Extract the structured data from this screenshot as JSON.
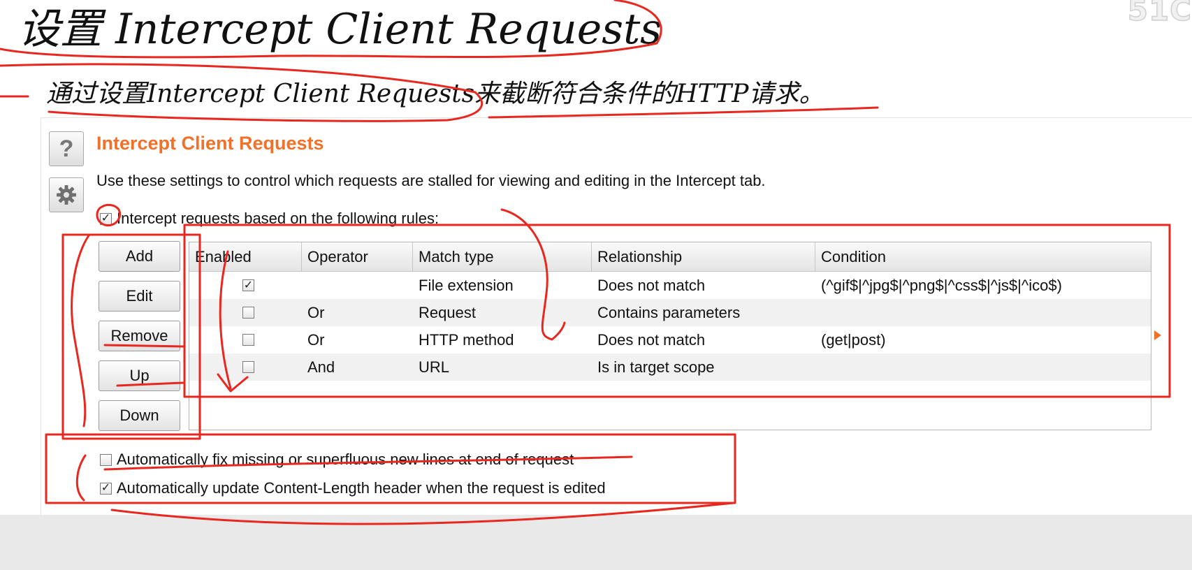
{
  "slide": {
    "title": "设置 Intercept Client Requests",
    "subtitle": "通过设置Intercept Client Requests来截断符合条件的HTTP请求。"
  },
  "panel": {
    "help_glyph": "?",
    "title": "Intercept Client Requests",
    "description": "Use these settings to control which requests are stalled for viewing and editing in the Intercept tab.",
    "intercept_rules": {
      "label": "Intercept requests based on the following rules:",
      "checked": true
    },
    "buttons": {
      "add": "Add",
      "edit": "Edit",
      "remove": "Remove",
      "up": "Up",
      "down": "Down"
    },
    "table": {
      "columns": [
        "Enabled",
        "Operator",
        "Match type",
        "Relationship",
        "Condition"
      ],
      "rows": [
        {
          "enabled": true,
          "operator": "",
          "match_type": "File extension",
          "relationship": "Does not match",
          "condition": "(^gif$|^jpg$|^png$|^css$|^js$|^ico$)"
        },
        {
          "enabled": false,
          "operator": "Or",
          "match_type": "Request",
          "relationship": "Contains parameters",
          "condition": ""
        },
        {
          "enabled": false,
          "operator": "Or",
          "match_type": "HTTP method",
          "relationship": "Does not match",
          "condition": "(get|post)"
        },
        {
          "enabled": false,
          "operator": "And",
          "match_type": "URL",
          "relationship": "Is in target scope",
          "condition": ""
        }
      ]
    },
    "options": [
      {
        "label": "Automatically fix missing or superfluous new lines at end of request",
        "checked": false
      },
      {
        "label": "Automatically update Content-Length header when the request is edited",
        "checked": true
      }
    ]
  },
  "colors": {
    "accent": "#f0712a",
    "annotation": "#e8281e",
    "row_alt": "#f1f1f1"
  },
  "icons": [
    "help-icon",
    "gear-icon",
    "checkbox-checked",
    "checkbox-unchecked",
    "scroll-right-arrow"
  ]
}
